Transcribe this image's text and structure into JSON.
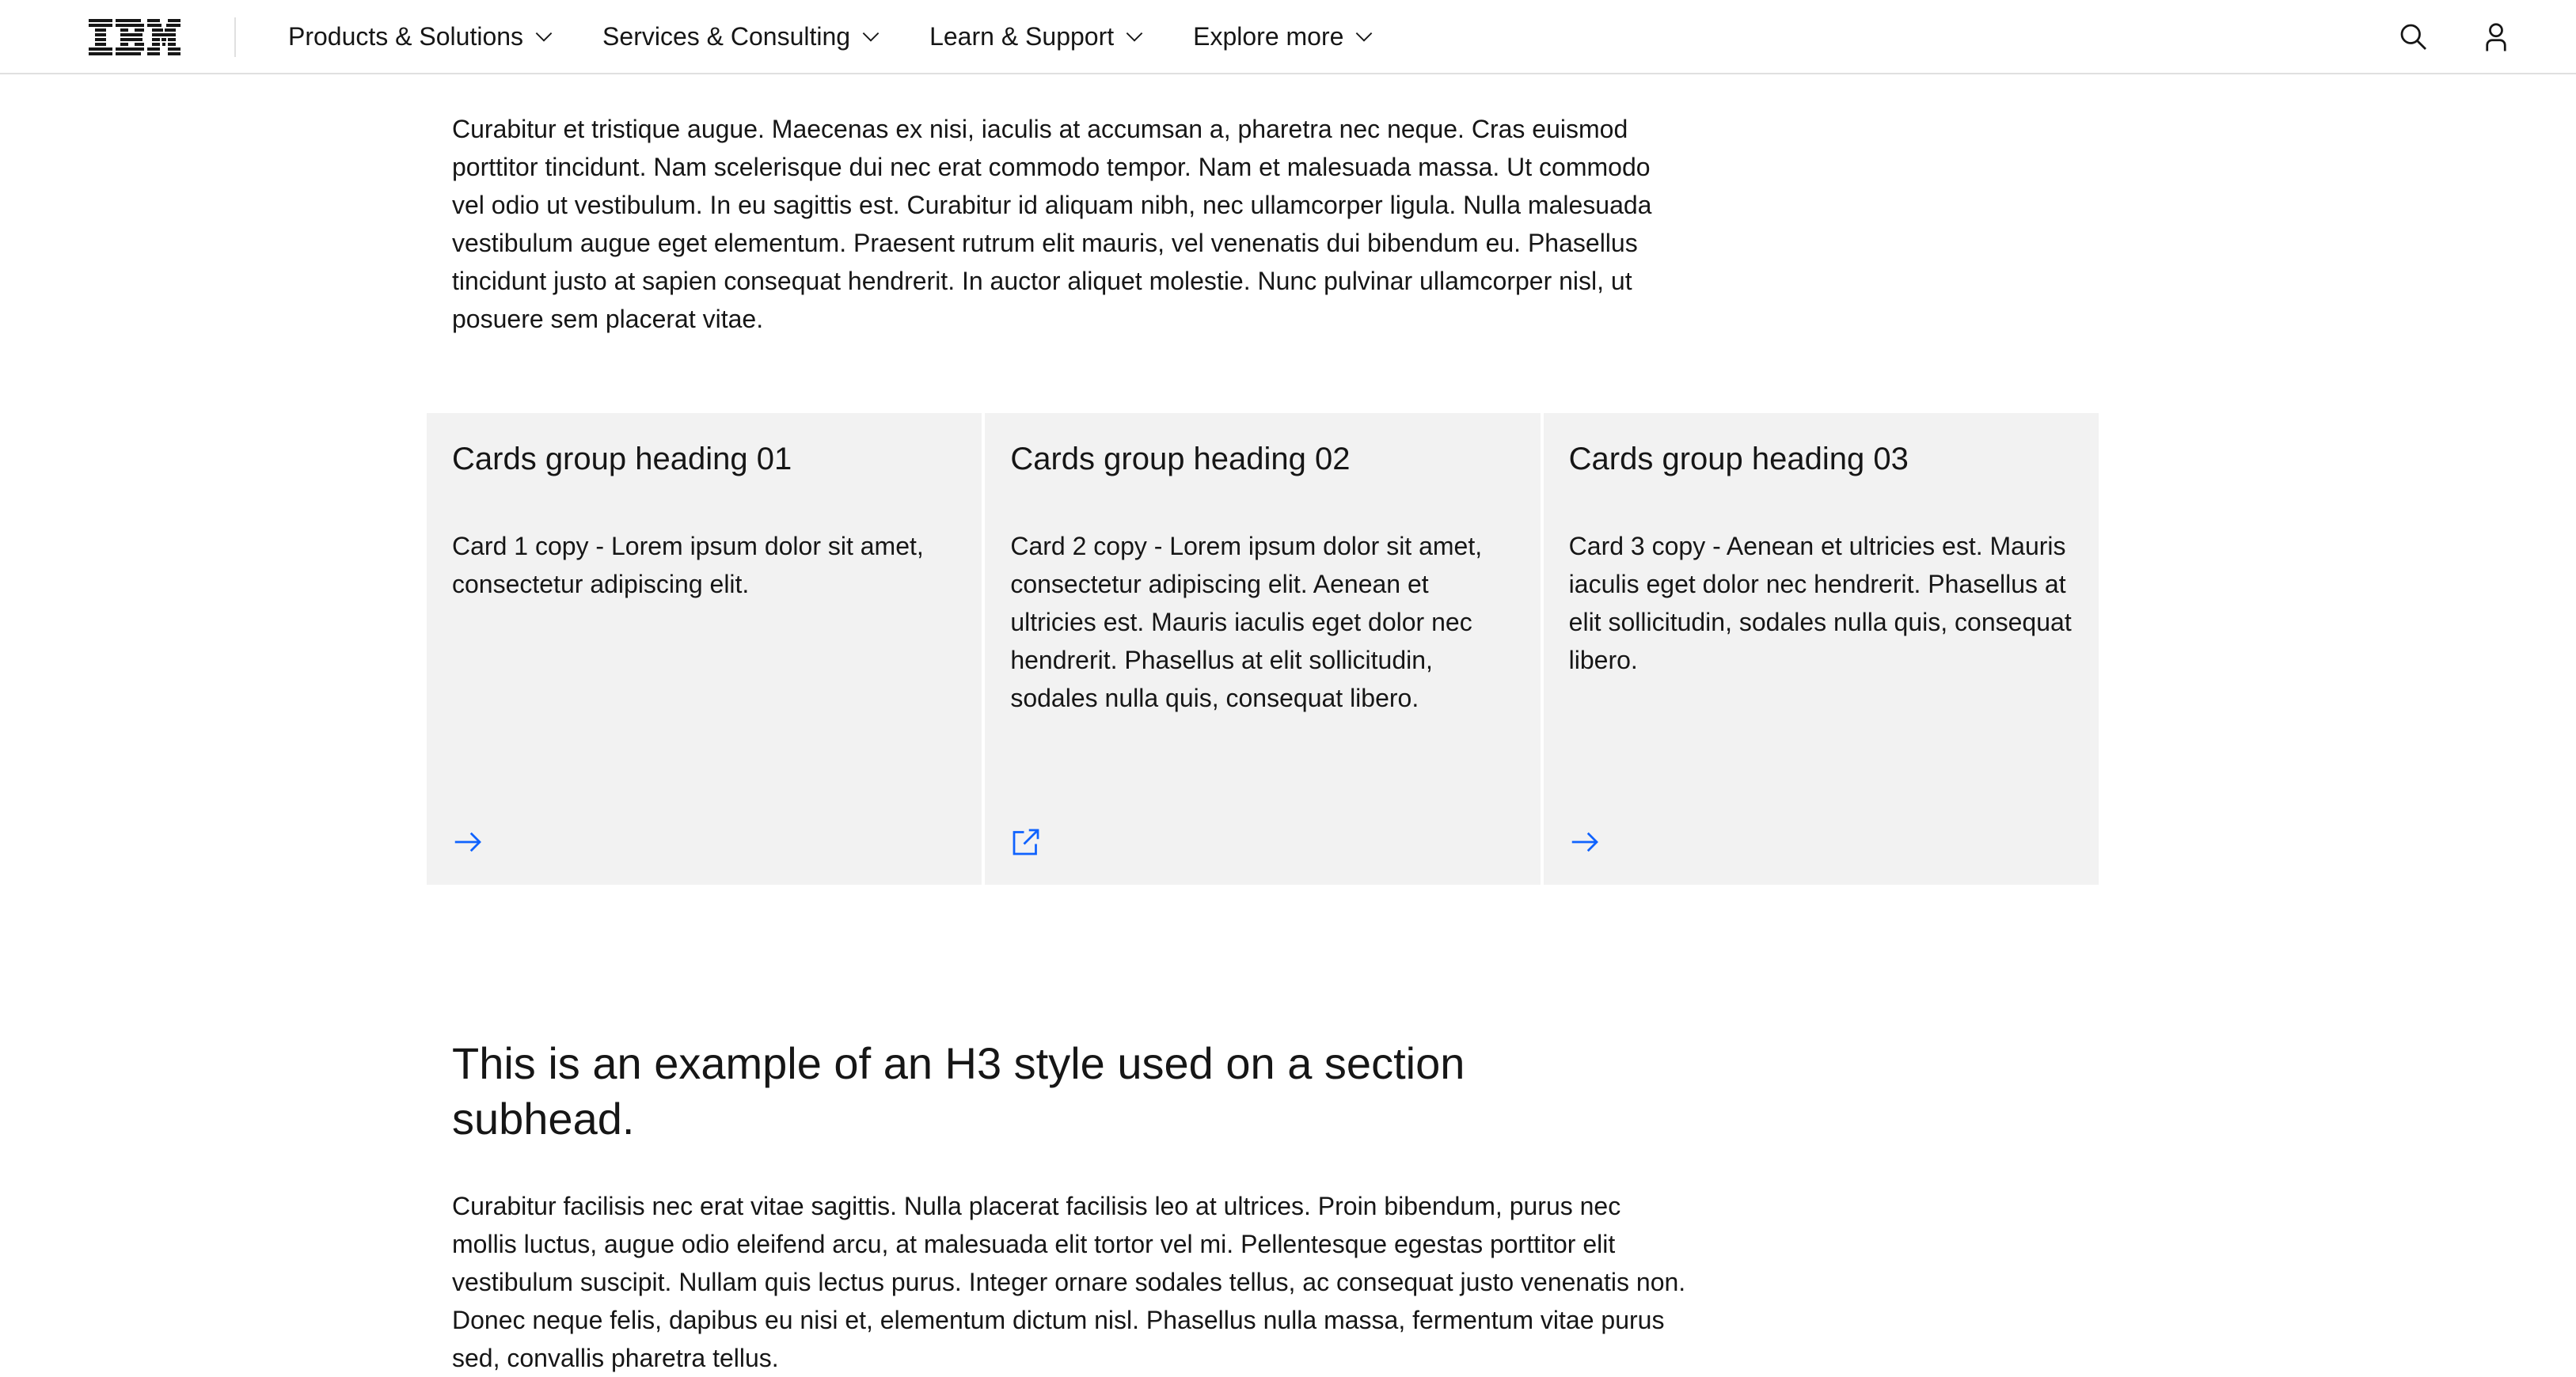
{
  "masthead": {
    "logo_text": "IBM",
    "nav": [
      {
        "label": "Products & Solutions"
      },
      {
        "label": "Services & Consulting"
      },
      {
        "label": "Learn & Support"
      },
      {
        "label": "Explore more"
      }
    ],
    "icons": {
      "search": "search-icon",
      "user": "user-icon",
      "chevron": "chevron-down-icon"
    }
  },
  "content": {
    "paragraph_1": "Curabitur et tristique augue. Maecenas ex nisi, iaculis at accumsan a, pharetra nec neque. Cras euismod porttitor tincidunt. Nam scelerisque dui nec erat commodo tempor. Nam et malesuada massa. Ut commodo vel odio ut vestibulum. In eu sagittis est. Curabitur id aliquam nibh, nec ullamcorper ligula. Nulla malesuada vestibulum augue eget elementum. Praesent rutrum elit mauris, vel venenatis dui bibendum eu. Phasellus tincidunt justo at sapien consequat hendrerit. In auctor aliquet molestie. Nunc pulvinar ullamcorper nisl, ut posuere sem placerat vitae.",
    "cards": [
      {
        "heading": "Cards group heading 01",
        "copy": "Card 1 copy - Lorem ipsum dolor sit amet, consectetur adipiscing elit.",
        "icon": "arrow-right-icon"
      },
      {
        "heading": "Cards group heading 02",
        "copy": "Card 2 copy - Lorem ipsum dolor sit amet, consectetur adipiscing elit. Aenean et ultricies est. Mauris iaculis eget dolor nec hendrerit. Phasellus at elit sollicitudin, sodales nulla quis, consequat libero.",
        "icon": "external-link-icon"
      },
      {
        "heading": "Cards group heading 03",
        "copy": "Card 3 copy - Aenean et ultricies est. Mauris iaculis eget dolor nec hendrerit. Phasellus at elit sollicitudin, sodales nulla quis, consequat libero.",
        "icon": "arrow-right-icon"
      }
    ],
    "h3": "This is an example of an H3 style used on a section subhead.",
    "paragraph_2": "Curabitur facilisis nec erat vitae sagittis. Nulla placerat facilisis leo at ultrices. Proin bibendum, purus nec mollis luctus, augue odio eleifend arcu, at malesuada elit tortor vel mi. Pellentesque egestas porttitor elit vestibulum suscipit. Nullam quis lectus purus. Integer ornare sodales tellus, ac consequat justo venenatis non. Donec neque felis, dapibus eu nisi et, elementum dictum nisl. Phasellus nulla massa, fermentum vitae purus sed, convallis pharetra tellus."
  },
  "colors": {
    "link_blue": "#0f62fe",
    "card_bg": "#f2f2f2",
    "text": "#161616",
    "border": "#e0e0e0"
  }
}
